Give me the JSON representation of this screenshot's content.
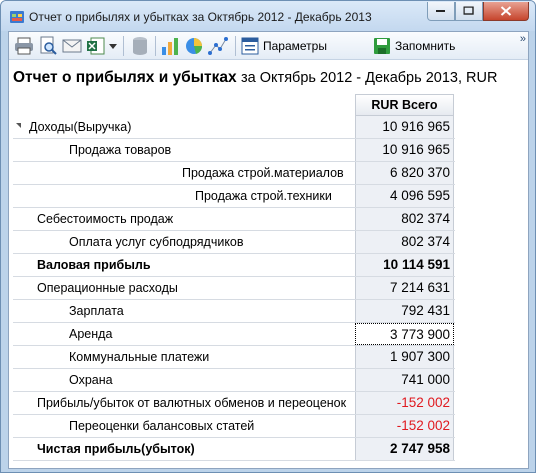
{
  "window": {
    "title": "Отчет о прибылях и убытках за Октябрь 2012 - Декабрь 2013"
  },
  "toolbar": {
    "params_label": "Параметры",
    "save_label": "Запомнить",
    "overflow_label": "»"
  },
  "report": {
    "title_main": "Отчет о прибылях и убытках",
    "title_sub": "за Октябрь 2012 - Декабрь 2013, RUR",
    "column_header": "RUR Всего",
    "rows": [
      {
        "label": "Доходы(Выручка)",
        "value": "10 916 965"
      },
      {
        "label": "Продажа товаров",
        "value": "10 916 965"
      },
      {
        "label": "Продажа строй.материалов",
        "value": "6 820 370"
      },
      {
        "label": "Продажа строй.техники",
        "value": "4 096 595"
      },
      {
        "label": "Себестоимость продаж",
        "value": "802 374"
      },
      {
        "label": "Оплата услуг субподрядчиков",
        "value": "802 374"
      },
      {
        "label": "Валовая прибыль",
        "value": "10 114 591"
      },
      {
        "label": "Операционные расходы",
        "value": "7 214 631"
      },
      {
        "label": "Зарплата",
        "value": "792 431"
      },
      {
        "label": "Аренда",
        "value": "3 773 900"
      },
      {
        "label": "Коммунальные платежи",
        "value": "1 907 300"
      },
      {
        "label": "Охрана",
        "value": "741 000"
      },
      {
        "label": "Прибыль/убыток от валютных обменов и переоценок",
        "value": "-152 002"
      },
      {
        "label": "Переоценки балансовых статей",
        "value": "-152 002"
      },
      {
        "label": "Чистая прибыль(убыток)",
        "value": "2 747 958"
      }
    ]
  },
  "colors": {
    "negative": "#e0191f",
    "value_cell_bg": "#edf0f5"
  }
}
